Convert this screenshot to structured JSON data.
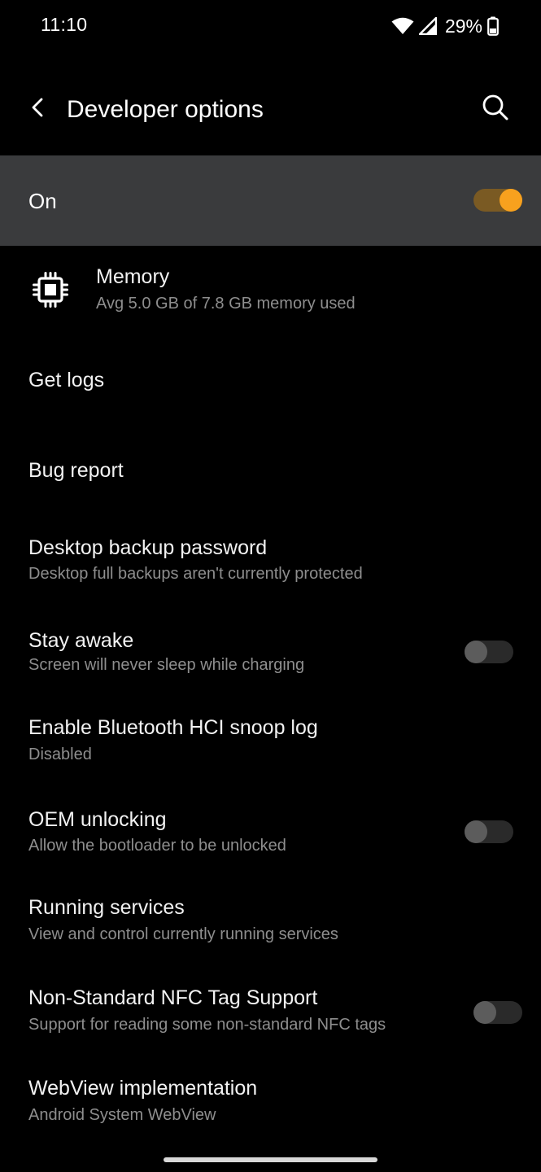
{
  "status_bar": {
    "time": "11:10",
    "battery_percent": "29%",
    "icons": [
      "wifi-icon",
      "cell-signal-icon",
      "battery-icon"
    ]
  },
  "app_bar": {
    "title": "Developer options",
    "back_icon": "back-arrow-icon",
    "search_icon": "search-icon"
  },
  "master_switch": {
    "label": "On",
    "checked": true,
    "accent_color": "#f8a11e"
  },
  "items": [
    {
      "title": "Memory",
      "subtitle": "Avg 5.0 GB of 7.8 GB memory used",
      "icon": "memory-chip-icon"
    },
    {
      "title": "Get logs"
    },
    {
      "title": "Bug report"
    },
    {
      "title": "Desktop backup password",
      "subtitle": "Desktop full backups aren't currently protected"
    },
    {
      "title": "Stay awake",
      "subtitle": "Screen will never sleep while charging",
      "toggle": false
    },
    {
      "title": "Enable Bluetooth HCI snoop log",
      "subtitle": "Disabled"
    },
    {
      "title": "OEM unlocking",
      "subtitle": "Allow the bootloader to be unlocked",
      "toggle": false
    },
    {
      "title": "Running services",
      "subtitle": "View and control currently running services"
    },
    {
      "title": "Non-Standard NFC Tag Support",
      "subtitle": "Support for reading some non-standard NFC tags",
      "toggle": false
    },
    {
      "title": "WebView implementation",
      "subtitle": "Android System WebView"
    }
  ]
}
